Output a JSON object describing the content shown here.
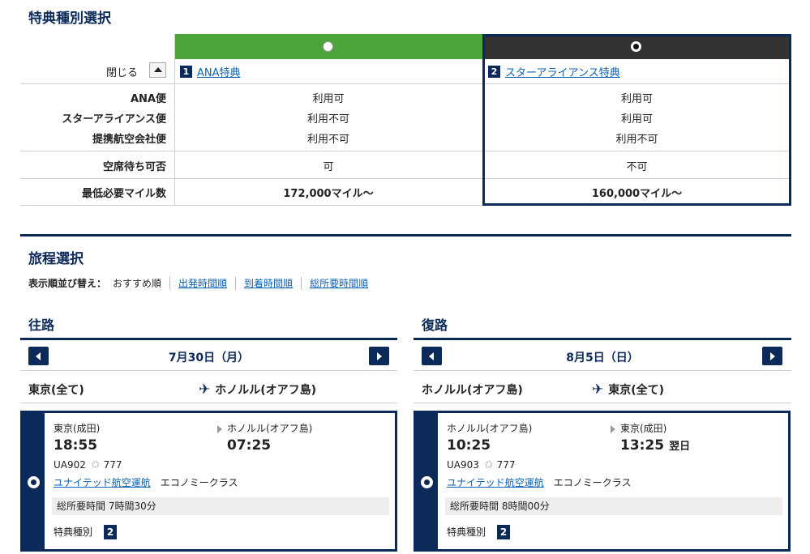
{
  "award_section": {
    "title": "特典種別選択",
    "close_label": "閉じる",
    "plans": [
      {
        "number": "1",
        "name": "ANA特典",
        "header_color": "#4ba53a",
        "selected": false
      },
      {
        "number": "2",
        "name": "スターアライアンス特典",
        "header_color": "#333333",
        "selected": true
      }
    ],
    "rows": [
      {
        "label": "ANA便",
        "values": [
          "利用可",
          "利用可"
        ]
      },
      {
        "label": "スターアライアンス便",
        "values": [
          "利用不可",
          "利用可"
        ]
      },
      {
        "label": "提携航空会社便",
        "values": [
          "利用不可",
          "利用不可"
        ]
      },
      {
        "label": "空席待ち可否",
        "values": [
          "可",
          "不可"
        ]
      },
      {
        "label": "最低必要マイル数",
        "values": [
          "172,000マイル〜",
          "160,000マイル〜"
        ]
      }
    ]
  },
  "itinerary": {
    "title": "旅程選択",
    "sort_label": "表示順並び替え：",
    "sort_options": [
      "おすすめ順",
      "出発時間順",
      "到着時間順",
      "総所要時間順"
    ],
    "outbound": {
      "title": "往路",
      "date": "7月30日（月）",
      "from": "東京(全て)",
      "to": "ホノルル(オアフ島)",
      "flight": {
        "dep_airport": "東京(成田)",
        "arr_airport": "ホノルル(オアフ島)",
        "dep_time": "18:55",
        "arr_time": "07:25",
        "arr_note": "",
        "flight_no": "UA902",
        "aircraft": "777",
        "operator": "ユナイテッド航空運航",
        "cabin": "エコノミークラス",
        "duration": "総所要時間 7時間30分",
        "award_label": "特典種別",
        "award_no": "2"
      }
    },
    "return": {
      "title": "復路",
      "date": "8月5日（日）",
      "from": "ホノルル(オアフ島)",
      "to": "東京(全て)",
      "flight": {
        "dep_airport": "ホノルル(オアフ島)",
        "arr_airport": "東京(成田)",
        "dep_time": "10:25",
        "arr_time": "13:25",
        "arr_note": "翌日",
        "flight_no": "UA903",
        "aircraft": "777",
        "operator": "ユナイテッド航空運航",
        "cabin": "エコノミークラス",
        "duration": "総所要時間 8時間00分",
        "award_label": "特典種別",
        "award_no": "2"
      }
    }
  }
}
